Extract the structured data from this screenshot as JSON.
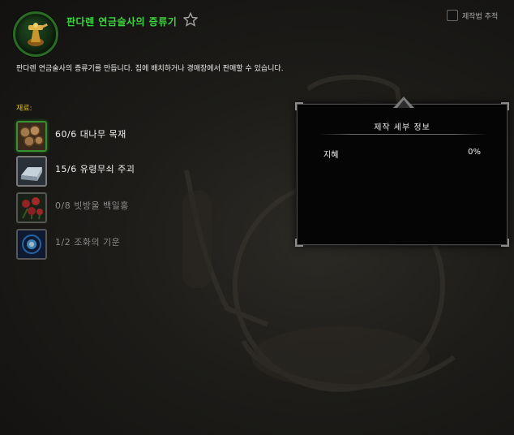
{
  "recipe": {
    "title": "판다렌 연금술사의 증류기",
    "description": "판다렌 연금술사의 증류기를 만듭니다. 집에 배치하거나 경매장에서 판매할 수 있습니다.",
    "icon": "alchemy-distiller-icon",
    "favorite_icon": "star-outline-icon"
  },
  "track": {
    "label": "제작법 추적",
    "checked": false
  },
  "reagents": {
    "label": "재료:",
    "items": [
      {
        "text": "60/6 대나무 목재",
        "icon": "bamboo-lumber-icon",
        "have": true
      },
      {
        "text": "15/6 유령무쇠 주괴",
        "icon": "ghost-iron-ingot-icon",
        "have": true
      },
      {
        "text": "0/8 빗방울 백일홍",
        "icon": "rain-poppy-icon",
        "have": false
      },
      {
        "text": "1/2 조화의 기운",
        "icon": "spirit-of-harmony-icon",
        "have": false
      }
    ]
  },
  "details": {
    "title": "제작 세부 정보",
    "stat_name": "지혜",
    "stat_value": "0%"
  },
  "colors": {
    "title_green": "#3cd43c",
    "reagent_label_gold": "#e6c200",
    "missing_gray": "#8a8a8a"
  }
}
